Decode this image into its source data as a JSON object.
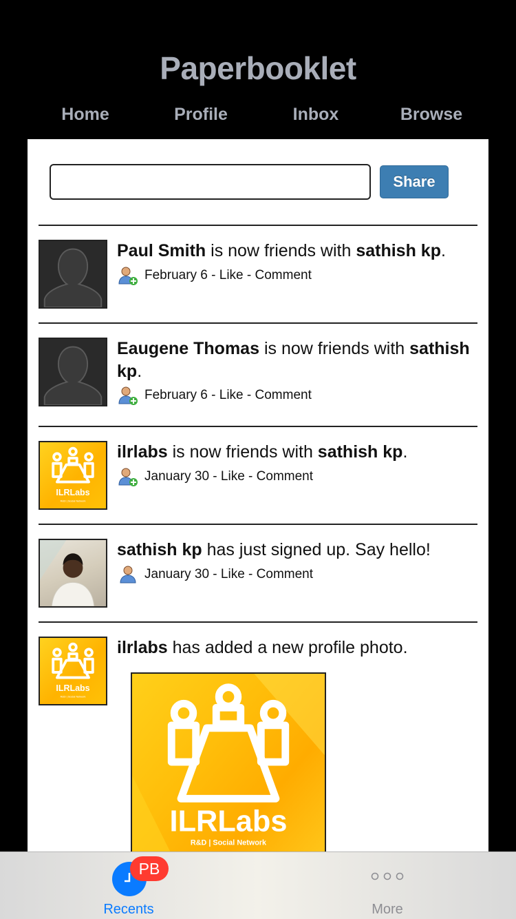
{
  "app": {
    "title": "Paperbooklet"
  },
  "nav": {
    "items": [
      "Home",
      "Profile",
      "Inbox",
      "Browse"
    ]
  },
  "composer": {
    "input_value": "",
    "share_label": "Share"
  },
  "feed": [
    {
      "avatar": "default-silhouette",
      "actor": "Paul Smith",
      "action": " is now friends with ",
      "target": "sathish kp",
      "suffix": ".",
      "icon": "friend-add-icon",
      "date": "February 6",
      "like": "Like",
      "comment": "Comment",
      "sep": " - "
    },
    {
      "avatar": "default-silhouette",
      "actor": "Eaugene Thomas",
      "action": " is now friends with ",
      "target": "sathish kp",
      "suffix": ".",
      "icon": "friend-add-icon",
      "date": "February 6",
      "like": "Like",
      "comment": "Comment",
      "sep": " - "
    },
    {
      "avatar": "ilrlabs-logo",
      "actor": "ilrlabs",
      "action": " is now friends with ",
      "target": "sathish kp",
      "suffix": ".",
      "icon": "friend-add-icon",
      "date": "January 30",
      "like": "Like",
      "comment": "Comment",
      "sep": " - "
    },
    {
      "avatar": "user-photo",
      "actor": "sathish kp",
      "action": " has just signed up. Say hello!",
      "target": "",
      "suffix": "",
      "icon": "user-icon",
      "date": "January 30",
      "like": "Like",
      "comment": "Comment",
      "sep": " - "
    },
    {
      "avatar": "ilrlabs-logo",
      "actor": "ilrlabs",
      "action": " has added a new profile photo.",
      "target": "",
      "suffix": "",
      "photo": {
        "brand": "ILRLabs",
        "tagline": "R&D | Social Network"
      }
    }
  ],
  "avatar_logo": {
    "brand": "ILRLabs",
    "tagline": "R&D | Social Network"
  },
  "tabbar": {
    "recents_label": "Recents",
    "badge": "PB",
    "more_label": "More",
    "more_icon": "ooo",
    "accent": "#0a7bff",
    "badge_color": "#ff3b30"
  }
}
